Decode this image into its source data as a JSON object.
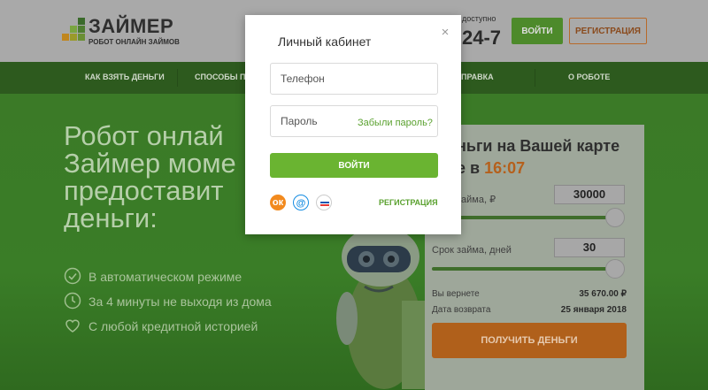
{
  "header": {
    "logo_title": "ЗАЙМЕР",
    "logo_subtitle": "РОБОТ ОНЛАЙН ЗАЙМОВ",
    "availability_label": "доступно",
    "availability_hours": "24-7",
    "login_button": "ВОЙТИ",
    "register_button": "РЕГИСТРАЦИЯ"
  },
  "nav": {
    "items": [
      "КАК ВЗЯТЬ ДЕНЬГИ",
      "СПОСОБЫ ПО",
      "ПРАВКА",
      "О РОБОТЕ"
    ]
  },
  "hero": {
    "title_lines": [
      "Робот онлай",
      "Займер моме",
      "предоставит",
      "деньги:"
    ],
    "features": [
      {
        "icon": "check-circle-icon",
        "text": "В автоматическом режиме"
      },
      {
        "icon": "clock-icon",
        "text": "За 4 минуты не выходя из дома"
      },
      {
        "icon": "heart-icon",
        "text": "С любой кредитной историей"
      }
    ]
  },
  "calculator": {
    "title_line1": "ньги на Вашей карте",
    "title_line2_prefix": "е в",
    "title_time": "16:07",
    "amount_label": "займа, ₽",
    "amount_value": "30000",
    "term_label": "Срок займа, дней",
    "term_value": "30",
    "return_label": "Вы вернете",
    "return_value": "35 670.00 ₽",
    "date_label": "Дата возврата",
    "date_value": "25 января 2018",
    "get_money_button": "ПОЛУЧИТЬ ДЕНЬГИ",
    "accent_color": "#b0601b"
  },
  "modal": {
    "title": "Личный кабинет",
    "phone_placeholder": "Телефон",
    "password_placeholder": "Пароль",
    "forgot_password": "Забыли пароль?",
    "submit_button": "ВОЙТИ",
    "register_link": "РЕГИСТРАЦИЯ",
    "socials": [
      {
        "icon": "odnoklassniki-icon",
        "glyph": "ок",
        "color": "#f28a1e"
      },
      {
        "icon": "mailru-icon",
        "glyph": "@",
        "color": "#168de2"
      },
      {
        "icon": "gosuslugi-icon",
        "glyph": "",
        "color": "#e53935"
      }
    ],
    "brand_color": "#6ab431"
  }
}
